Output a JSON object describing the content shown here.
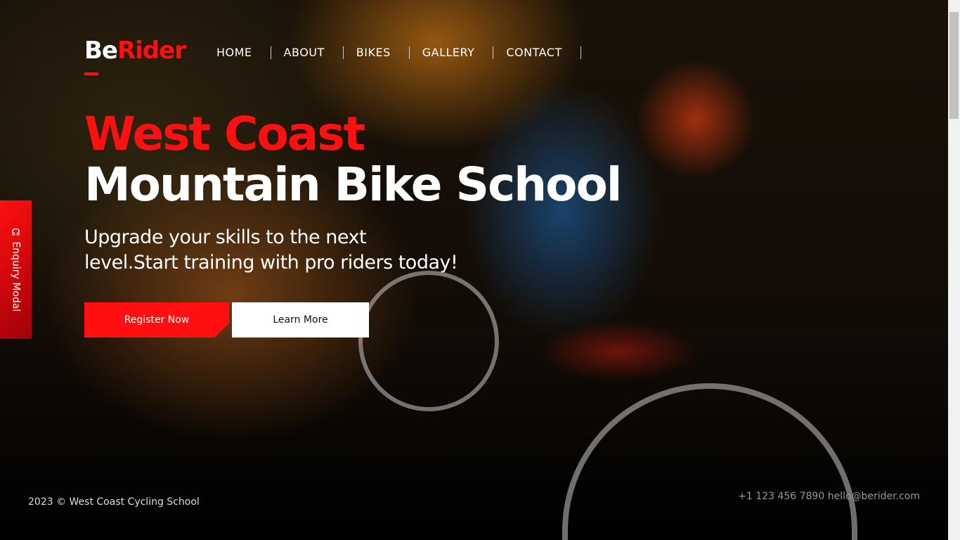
{
  "logo": {
    "part1": "Be",
    "part2": "Rider"
  },
  "nav": [
    "HOME",
    "ABOUT",
    "BIKES",
    "GALLERY",
    "CONTACT"
  ],
  "hero": {
    "title_line1": "West Coast",
    "title_line2": "Mountain Bike School",
    "subtitle": "Upgrade your skills to the next level.Start training with pro riders today!",
    "register": "Register Now",
    "learn_more": "Learn More"
  },
  "enquiry": {
    "label": "Enquiry Modal",
    "icon": "headset-icon"
  },
  "footer": {
    "copyright": "2023 © West Coast Cycling School",
    "contact": "+1 123 456 7890 hello@berider.com"
  },
  "colors": {
    "accent": "#ff1010"
  }
}
